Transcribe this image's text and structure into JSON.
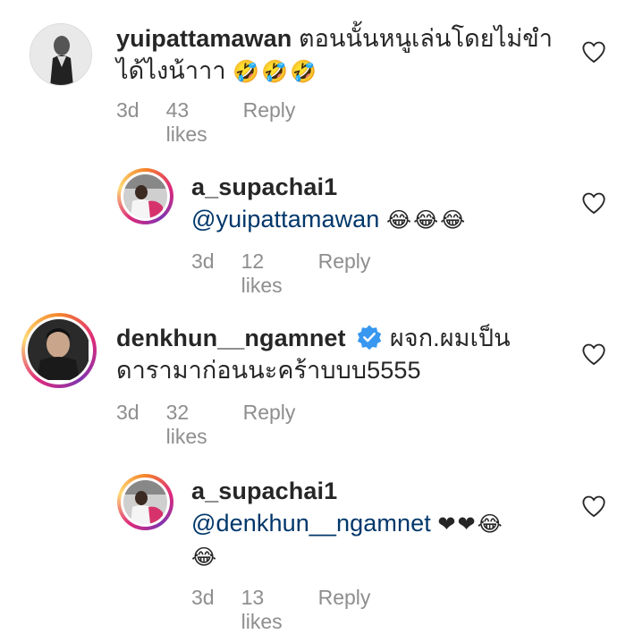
{
  "comments": [
    {
      "username": "yuipattamawan",
      "text_line1": "ตอนนั้นหนูเล่นโดยไม่ขำ",
      "text_line2": "ได้ไงน้าาา",
      "emoji": "🤣🤣🤣",
      "time": "3d",
      "likes": "43 likes",
      "reply": "Reply"
    },
    {
      "username": "a_supachai1",
      "mention": "@yuipattamawan",
      "emoji": "😂😂😂",
      "time": "3d",
      "likes": "12 likes",
      "reply": "Reply"
    },
    {
      "username": "denkhun__ngamnet",
      "text_line1": "ผจก.ผมเป็น",
      "text_line2": "ดารามาก่อนนะคร้าบบบ5555",
      "time": "3d",
      "likes": "32 likes",
      "reply": "Reply"
    },
    {
      "username": "a_supachai1",
      "mention": "@denkhun__ngamnet",
      "emoji": "❤❤😂",
      "emoji_line2": "😂",
      "time": "3d",
      "likes": "13 likes",
      "reply": "Reply"
    }
  ],
  "colors": {
    "text": "#262626",
    "meta": "#8e8e8e",
    "mention": "#00376b",
    "verified": "#3897f0"
  },
  "icons": {
    "like": "heart-outline-icon",
    "verified": "verified-badge-icon"
  }
}
